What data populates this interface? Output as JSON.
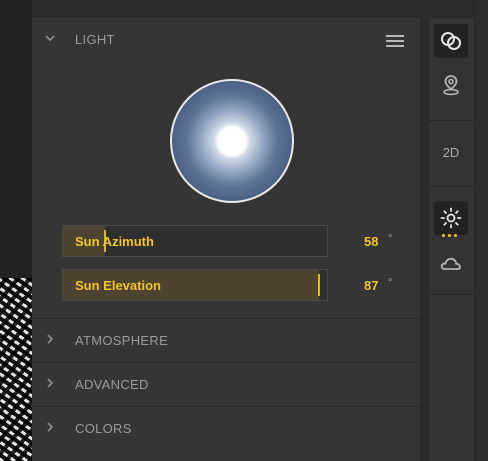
{
  "sections": {
    "light": {
      "title": "LIGHT",
      "expanded": true
    },
    "atmosphere": {
      "title": "ATMOSPHERE",
      "expanded": false
    },
    "advanced": {
      "title": "ADVANCED",
      "expanded": false
    },
    "colors": {
      "title": "COLORS",
      "expanded": false
    }
  },
  "sliders": {
    "azimuth": {
      "label": "Sun Azimuth",
      "value": "58",
      "unit": "°",
      "fill_fraction": 0.16
    },
    "elevation": {
      "label": "Sun Elevation",
      "value": "87",
      "unit": "°",
      "fill_fraction": 0.97
    }
  },
  "toolbar": {
    "view_2d_label": "2D",
    "items": [
      "layers-icon",
      "location-pin-icon",
      "2d-view",
      "sun-icon",
      "cloud-icon"
    ],
    "active": [
      "layers-icon",
      "sun-icon"
    ]
  },
  "colors": {
    "accent": "#f5c530",
    "panel_bg": "#353535",
    "dial_blue": "#4c6185"
  }
}
